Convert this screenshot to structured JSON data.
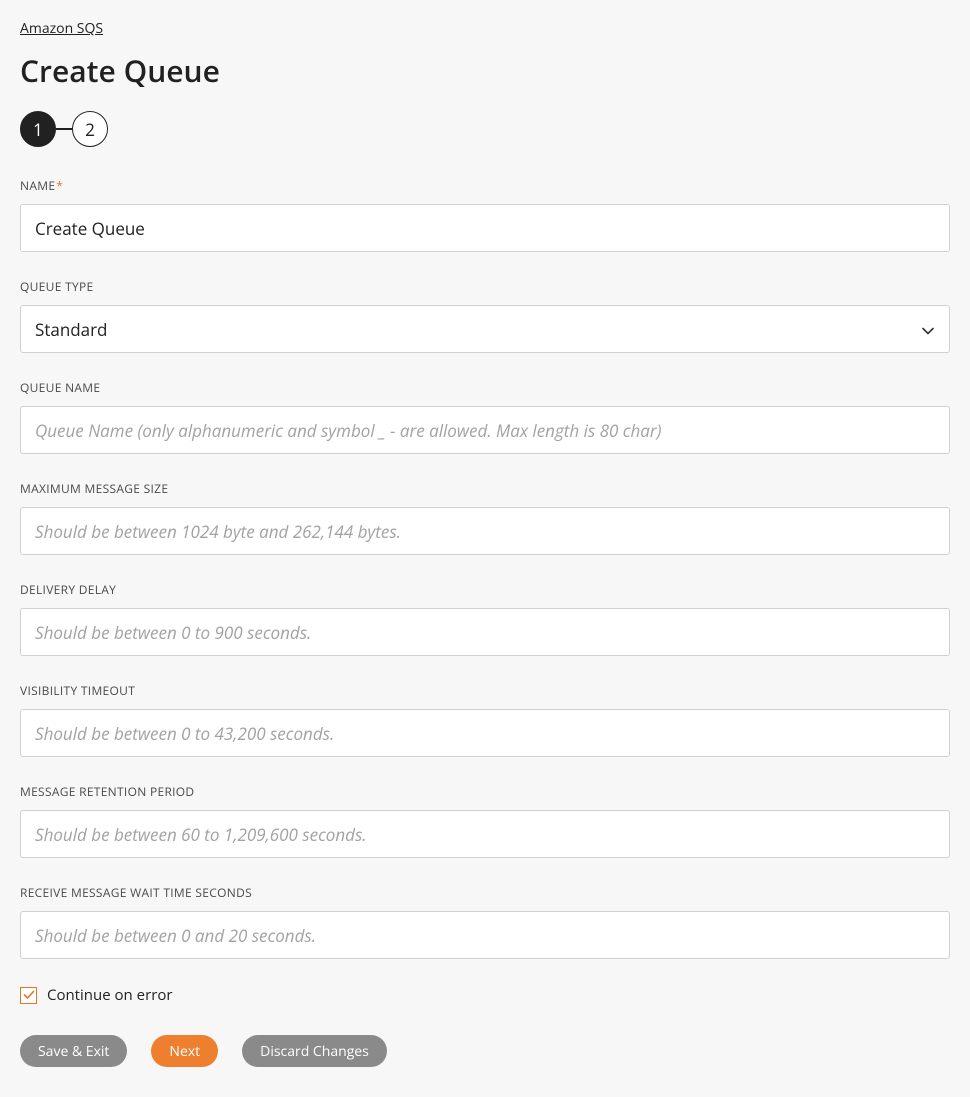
{
  "breadcrumb": "Amazon SQS",
  "page_title": "Create Queue",
  "stepper": {
    "step1": "1",
    "step2": "2"
  },
  "fields": {
    "name": {
      "label": "Name",
      "value": "Create Queue"
    },
    "queue_type": {
      "label": "Queue Type",
      "value": "Standard"
    },
    "queue_name": {
      "label": "Queue Name",
      "placeholder": "Queue Name (only alphanumeric and symbol _ - are allowed. Max length is 80 char)"
    },
    "max_msg_size": {
      "label": "Maximum Message Size",
      "placeholder": "Should be between 1024 byte and 262,144 bytes."
    },
    "delivery_delay": {
      "label": "Delivery Delay",
      "placeholder": "Should be between 0 to 900 seconds."
    },
    "visibility_timeout": {
      "label": "Visibility Timeout",
      "placeholder": "Should be between 0 to 43,200 seconds."
    },
    "msg_retention": {
      "label": "Message Retention Period",
      "placeholder": "Should be between 60 to 1,209,600 seconds."
    },
    "receive_wait": {
      "label": "Receive Message Wait Time Seconds",
      "placeholder": "Should be between 0 and 20 seconds."
    }
  },
  "continue_on_error": {
    "label": "Continue on error",
    "checked": true
  },
  "buttons": {
    "save_exit": "Save & Exit",
    "next": "Next",
    "discard": "Discard Changes"
  }
}
